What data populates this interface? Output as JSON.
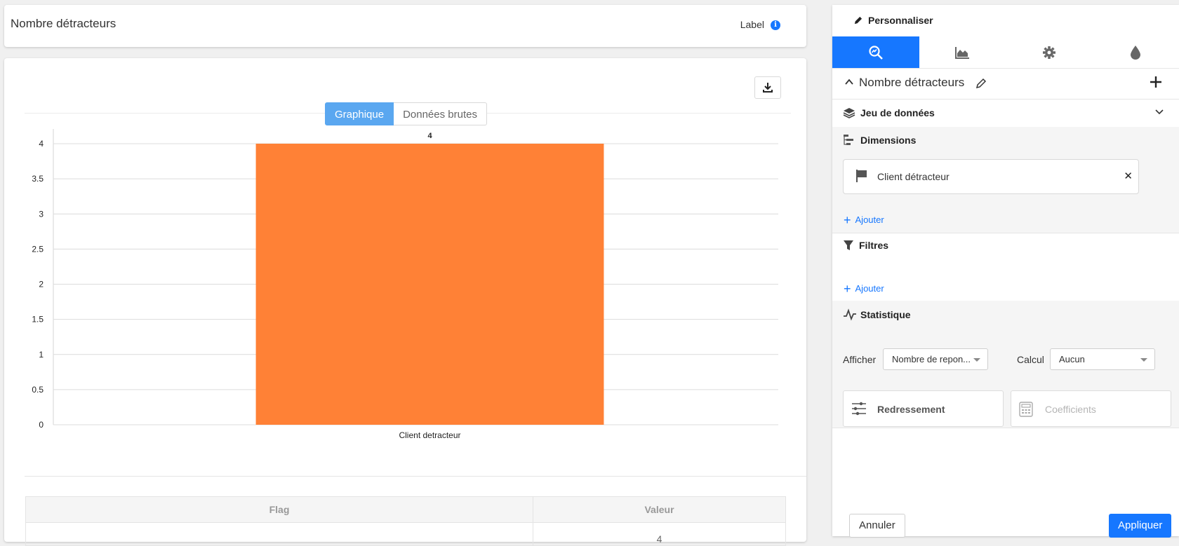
{
  "header": {
    "title": "Nombre détracteurs",
    "label": "Label",
    "info_icon": "info-icon"
  },
  "view_tabs": {
    "chart": "Graphique",
    "raw": "Données brutes"
  },
  "chart_data": {
    "type": "bar",
    "categories": [
      "Client detracteur"
    ],
    "values": [
      4
    ],
    "ylim": [
      0,
      4
    ],
    "yticks": [
      "0",
      "0.5",
      "1",
      "1.5",
      "2",
      "2.5",
      "3",
      "3.5",
      "4"
    ],
    "data_labels": [
      "4"
    ],
    "bar_color": "#ff8136",
    "grid": true
  },
  "table": {
    "headers": [
      "Flag",
      "Valeur"
    ],
    "rows": [
      [
        "",
        "4"
      ]
    ]
  },
  "panel": {
    "title": "Personnaliser",
    "tabs": [
      "analysis-icon",
      "area-chart-icon",
      "gear-icon",
      "drop-icon"
    ],
    "metric_title": "Nombre détracteurs",
    "dataset": "Jeu de données",
    "dimensions": {
      "title": "Dimensions",
      "items": [
        "Client détracteur"
      ],
      "add": "Ajouter"
    },
    "filters": {
      "title": "Filtres",
      "add": "Ajouter"
    },
    "stats": {
      "title": "Statistique",
      "afficher_label": "Afficher",
      "afficher_value": "Nombre de repon...",
      "calcul_label": "Calcul",
      "calcul_value": "Aucun",
      "redressement": "Redressement",
      "coefficients": "Coefficients"
    },
    "cancel": "Annuler",
    "apply": "Appliquer"
  },
  "colors": {
    "accent": "#1677ff",
    "tab_active": "#5aa7f0",
    "bar": "#ff8136"
  }
}
